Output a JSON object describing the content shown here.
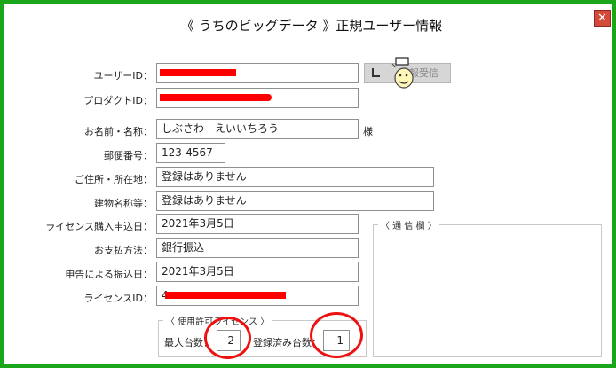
{
  "window": {
    "title": "《 うちのビッグデータ 》正規ユーザー情報",
    "close_glyph": "✕"
  },
  "form": {
    "user_id": {
      "label": "ユーザーID：",
      "value": ""
    },
    "product_id": {
      "label": "プロダクトID：",
      "value": ""
    },
    "name": {
      "label": "お名前・名称：",
      "value": "しぶさわ　えいいちろう",
      "suffix": "様"
    },
    "postal_code": {
      "label": "郵便番号：",
      "value": "123-4567"
    },
    "address": {
      "label": "ご住所・所在地：",
      "value": "登録はありません"
    },
    "building": {
      "label": "建物名称等：",
      "value": "登録はありません"
    },
    "license_apply_date": {
      "label": "ライセンス購入申込日：",
      "value": "2021年3月5日"
    },
    "payment_method": {
      "label": "お支払方法：",
      "value": "銀行振込"
    },
    "transfer_date": {
      "label": "申告による振込日：",
      "value": "2021年3月5日"
    },
    "license_id": {
      "label": "ライセンスID：",
      "value": "4"
    }
  },
  "receive_button": {
    "label": "報受信",
    "icon": "receive-icon"
  },
  "comm_panel": {
    "caption": "〈 通 信 欄 〉"
  },
  "license_group": {
    "caption": "〈 使用許可ライセンス 〉",
    "max_units_label": "最大台数：",
    "max_units_value": "2",
    "registered_label": "登録済み台数：",
    "registered_value": "1"
  },
  "colors": {
    "frame_border": "#1aa51a",
    "redaction": "#ff0000",
    "highlight_circle": "#ee1111"
  }
}
